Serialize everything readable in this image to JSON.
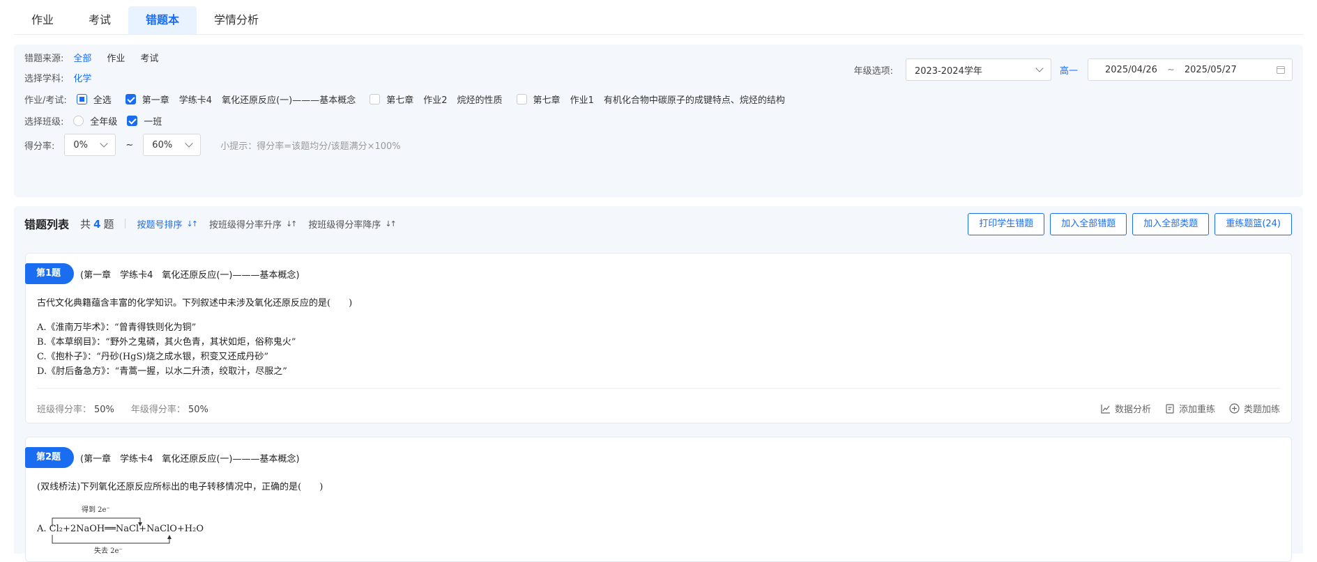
{
  "tabs": [
    {
      "label": "作业"
    },
    {
      "label": "考试"
    },
    {
      "label": "错题本"
    },
    {
      "label": "学情分析"
    }
  ],
  "filters": {
    "source_label": "错题来源:",
    "source_options": [
      "全部",
      "作业",
      "考试"
    ],
    "subject_label": "选择学科:",
    "subject_value": "化学",
    "homework_label": "作业/考试:",
    "select_all": "全选",
    "homework_items": [
      {
        "chapter": "第一章",
        "card": "学练卡4",
        "topic": "氧化还原反应(一)———基本概念"
      },
      {
        "chapter": "第七章",
        "card": "作业2",
        "topic": "烷烃的性质"
      },
      {
        "chapter": "第七章",
        "card": "作业1",
        "topic": "有机化合物中碳原子的成键特点、烷烃的结构"
      }
    ],
    "class_label": "选择班级:",
    "class_options": [
      "全年级",
      "一班"
    ],
    "score_label": "得分率:",
    "score_min": "0%",
    "score_sep": "~",
    "score_max": "60%",
    "hint": "小提示：得分率=该题均分/该题满分×100%",
    "year_label": "年级选项:",
    "year_value": "2023-2024学年",
    "grade_value": "高一",
    "date_start": "2025/04/26",
    "date_sep": "~",
    "date_end": "2025/05/27"
  },
  "list": {
    "title": "错题列表",
    "count_prefix": "共",
    "count": "4",
    "count_suffix": "题",
    "sorts": [
      "按题号排序",
      "按班级得分率升序",
      "按班级得分率降序"
    ],
    "actions": [
      "打印学生错题",
      "加入全部错题",
      "加入全部类题",
      "重练题篮(24)"
    ]
  },
  "questions": [
    {
      "badge": "第1题",
      "source": [
        "(第一章",
        "学练卡4",
        "氧化还原反应(一)———基本概念)"
      ],
      "text": "古代文化典籍蕴含丰富的化学知识。下列叙述中未涉及氧化还原反应的是(　　)",
      "options": [
        "A.《淮南万毕术》：“曾青得铁则化为铜”",
        "B.《本草纲目》：“野外之鬼磷，其火色青，其状如炬，俗称鬼火”",
        "C.《抱朴子》：“丹砂(HgS)烧之成水银，积变又还成丹砂”",
        "D.《肘后备急方》：“青蒿一握，以水二升渍，绞取汁，尽服之”"
      ],
      "class_rate_label": "班级得分率：",
      "class_rate": "50%",
      "grade_rate_label": "年级得分率：",
      "grade_rate": "50%",
      "actions": [
        "数据分析",
        "添加重练",
        "类题加练"
      ]
    },
    {
      "badge": "第2题",
      "source": [
        "(第一章",
        "学练卡4",
        "氧化还原反应(一)———基本概念)"
      ],
      "text": "(双线桥法)下列氧化还原反应所标出的电子转移情况中，正确的是(　　)",
      "formula": {
        "top": "得到 2e⁻",
        "main": "A. Cl₂+2NaOH══NaCl+NaClO+H₂O",
        "bottom": "失去 2e⁻"
      }
    }
  ],
  "colors": {
    "accent": "#1a6cf0",
    "panel": "#f4f8fc",
    "tab_active_bg": "#e8f3ff"
  }
}
